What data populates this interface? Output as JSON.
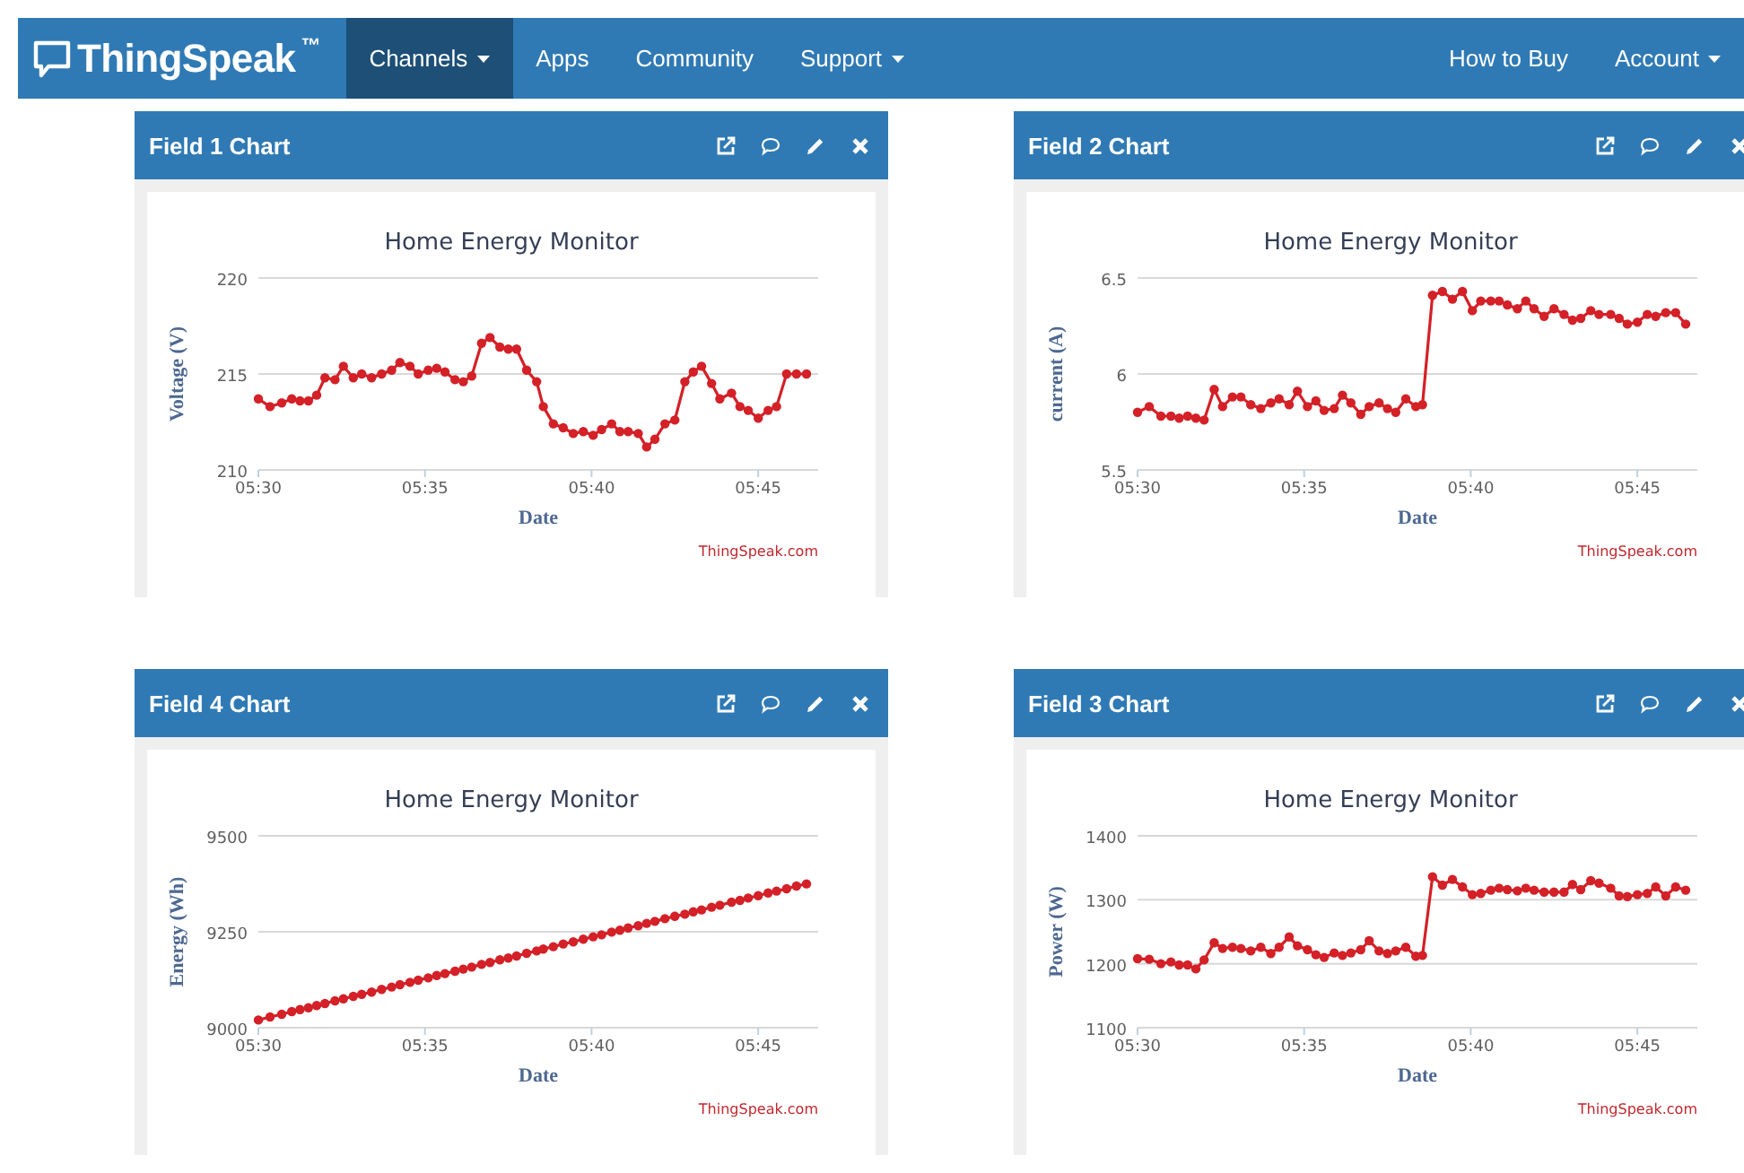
{
  "nav": {
    "logo": "ThingSpeak",
    "trademark": "™",
    "items": [
      {
        "label": "Channels",
        "dropdown": true,
        "selected": true
      },
      {
        "label": "Apps",
        "dropdown": false,
        "selected": false
      },
      {
        "label": "Community",
        "dropdown": false,
        "selected": false
      },
      {
        "label": "Support",
        "dropdown": true,
        "selected": false
      }
    ],
    "right_items": [
      {
        "label": "How to Buy",
        "dropdown": false,
        "selected": false
      },
      {
        "label": "Account",
        "dropdown": true,
        "selected": false
      }
    ]
  },
  "panels": [
    {
      "title": "Field 1 Chart",
      "credit": "ThingSpeak.com",
      "chart_data": {
        "type": "line",
        "title": "Home Energy Monitor",
        "xlabel": "Date",
        "ylabel": "Voltage (V)",
        "xlim": [
          330,
          346.8
        ],
        "ylim": [
          210,
          220
        ],
        "yticks": [
          210,
          215,
          220
        ],
        "xticks": [
          {
            "value": 330,
            "label": "05:30"
          },
          {
            "value": 335,
            "label": "05:35"
          },
          {
            "value": 340,
            "label": "05:40"
          },
          {
            "value": 345,
            "label": "05:45"
          }
        ],
        "x": [
          330,
          330.35,
          330.7,
          331,
          331.25,
          331.5,
          331.75,
          332,
          332.3,
          332.55,
          332.85,
          333.1,
          333.4,
          333.7,
          334,
          334.25,
          334.55,
          334.8,
          335.1,
          335.35,
          335.6,
          335.9,
          336.15,
          336.4,
          336.7,
          336.95,
          337.25,
          337.5,
          337.75,
          338.05,
          338.35,
          338.55,
          338.85,
          339.15,
          339.45,
          339.75,
          340.05,
          340.3,
          340.6,
          340.85,
          341.1,
          341.4,
          341.65,
          341.9,
          342.2,
          342.5,
          342.8,
          343.05,
          343.3,
          343.6,
          343.85,
          344.2,
          344.45,
          344.7,
          345,
          345.3,
          345.55,
          345.85,
          346.15,
          346.45
        ],
        "series": [
          {
            "color": "#d42027",
            "values": [
              213.7,
              213.3,
              213.5,
              213.7,
              213.6,
              213.6,
              213.9,
              214.8,
              214.7,
              215.4,
              214.8,
              215,
              214.8,
              215,
              215.2,
              215.6,
              215.4,
              215,
              215.2,
              215.3,
              215.1,
              214.7,
              214.6,
              214.9,
              216.6,
              216.9,
              216.4,
              216.3,
              216.3,
              215.2,
              214.6,
              213.3,
              212.4,
              212.2,
              211.9,
              212,
              211.8,
              212.1,
              212.4,
              212,
              212,
              211.9,
              211.2,
              211.6,
              212.4,
              212.6,
              214.6,
              215.1,
              215.4,
              214.5,
              213.7,
              214,
              213.3,
              213.1,
              212.7,
              213.1,
              213.3,
              215,
              215,
              215
            ]
          }
        ]
      }
    },
    {
      "title": "Field 2 Chart",
      "credit": "ThingSpeak.com",
      "chart_data": {
        "type": "line",
        "title": "Home Energy Monitor",
        "xlabel": "Date",
        "ylabel": "current (A)",
        "xlim": [
          330,
          346.8
        ],
        "ylim": [
          5.5,
          6.5
        ],
        "yticks": [
          5.5,
          6,
          6.5
        ],
        "xticks": [
          {
            "value": 330,
            "label": "05:30"
          },
          {
            "value": 335,
            "label": "05:35"
          },
          {
            "value": 340,
            "label": "05:40"
          },
          {
            "value": 345,
            "label": "05:45"
          }
        ],
        "x": [
          330,
          330.35,
          330.7,
          331,
          331.25,
          331.5,
          331.75,
          332,
          332.3,
          332.55,
          332.85,
          333.1,
          333.4,
          333.7,
          334,
          334.25,
          334.55,
          334.8,
          335.1,
          335.35,
          335.6,
          335.9,
          336.15,
          336.4,
          336.7,
          336.95,
          337.25,
          337.5,
          337.75,
          338.05,
          338.35,
          338.55,
          338.85,
          339.15,
          339.45,
          339.75,
          340.05,
          340.3,
          340.6,
          340.85,
          341.1,
          341.4,
          341.65,
          341.9,
          342.2,
          342.5,
          342.8,
          343.05,
          343.3,
          343.6,
          343.85,
          344.2,
          344.45,
          344.7,
          345,
          345.3,
          345.55,
          345.85,
          346.15,
          346.45
        ],
        "series": [
          {
            "color": "#d42027",
            "values": [
              5.8,
              5.83,
              5.78,
              5.78,
              5.77,
              5.78,
              5.77,
              5.76,
              5.92,
              5.83,
              5.88,
              5.88,
              5.84,
              5.82,
              5.85,
              5.87,
              5.84,
              5.91,
              5.83,
              5.86,
              5.81,
              5.82,
              5.89,
              5.85,
              5.79,
              5.83,
              5.85,
              5.82,
              5.8,
              5.87,
              5.83,
              5.84,
              6.41,
              6.43,
              6.39,
              6.43,
              6.33,
              6.38,
              6.38,
              6.38,
              6.36,
              6.34,
              6.38,
              6.34,
              6.3,
              6.34,
              6.31,
              6.28,
              6.29,
              6.33,
              6.31,
              6.31,
              6.29,
              6.26,
              6.27,
              6.31,
              6.3,
              6.32,
              6.32,
              6.26
            ]
          }
        ]
      }
    },
    {
      "title": "Field 4 Chart",
      "credit": "ThingSpeak.com",
      "chart_data": {
        "type": "line",
        "title": "Home Energy Monitor",
        "xlabel": "Date",
        "ylabel": "Energy (Wh)",
        "xlim": [
          330,
          346.8
        ],
        "ylim": [
          9000,
          9500
        ],
        "yticks": [
          9000,
          9250,
          9500
        ],
        "xticks": [
          {
            "value": 330,
            "label": "05:30"
          },
          {
            "value": 335,
            "label": "05:35"
          },
          {
            "value": 340,
            "label": "05:40"
          },
          {
            "value": 345,
            "label": "05:45"
          }
        ],
        "x": [
          330,
          330.35,
          330.7,
          331,
          331.25,
          331.5,
          331.75,
          332,
          332.3,
          332.55,
          332.85,
          333.1,
          333.4,
          333.7,
          334,
          334.25,
          334.55,
          334.8,
          335.1,
          335.35,
          335.6,
          335.9,
          336.15,
          336.4,
          336.7,
          336.95,
          337.25,
          337.5,
          337.75,
          338.05,
          338.35,
          338.55,
          338.85,
          339.15,
          339.45,
          339.75,
          340.05,
          340.3,
          340.6,
          340.85,
          341.1,
          341.4,
          341.65,
          341.9,
          342.2,
          342.5,
          342.8,
          343.05,
          343.3,
          343.6,
          343.85,
          344.2,
          344.45,
          344.7,
          345,
          345.3,
          345.55,
          345.85,
          346.15,
          346.45
        ],
        "series": [
          {
            "color": "#d42027",
            "values": [
              9020,
              9028,
              9035,
              9042,
              9047,
              9052,
              9058,
              9063,
              9070,
              9075,
              9082,
              9087,
              9093,
              9100,
              9106,
              9112,
              9118,
              9124,
              9130,
              9136,
              9141,
              9147,
              9153,
              9158,
              9165,
              9170,
              9177,
              9182,
              9187,
              9194,
              9200,
              9205,
              9211,
              9218,
              9224,
              9231,
              9237,
              9242,
              9249,
              9254,
              9260,
              9266,
              9272,
              9277,
              9284,
              9290,
              9296,
              9302,
              9307,
              9314,
              9319,
              9327,
              9332,
              9338,
              9344,
              9351,
              9356,
              9362,
              9369,
              9375
            ]
          }
        ]
      }
    },
    {
      "title": "Field 3 Chart",
      "credit": "ThingSpeak.com",
      "chart_data": {
        "type": "line",
        "title": "Home Energy Monitor",
        "xlabel": "Date",
        "ylabel": "Power (W)",
        "xlim": [
          330,
          346.8
        ],
        "ylim": [
          1100,
          1400
        ],
        "yticks": [
          1100,
          1200,
          1300,
          1400
        ],
        "xticks": [
          {
            "value": 330,
            "label": "05:30"
          },
          {
            "value": 335,
            "label": "05:35"
          },
          {
            "value": 340,
            "label": "05:40"
          },
          {
            "value": 345,
            "label": "05:45"
          }
        ],
        "x": [
          330,
          330.35,
          330.7,
          331,
          331.25,
          331.5,
          331.75,
          332,
          332.3,
          332.55,
          332.85,
          333.1,
          333.4,
          333.7,
          334,
          334.25,
          334.55,
          334.8,
          335.1,
          335.35,
          335.6,
          335.9,
          336.15,
          336.4,
          336.7,
          336.95,
          337.25,
          337.5,
          337.75,
          338.05,
          338.35,
          338.55,
          338.85,
          339.15,
          339.45,
          339.75,
          340.05,
          340.3,
          340.6,
          340.85,
          341.1,
          341.4,
          341.65,
          341.9,
          342.2,
          342.5,
          342.8,
          343.05,
          343.3,
          343.6,
          343.85,
          344.2,
          344.45,
          344.7,
          345,
          345.3,
          345.55,
          345.85,
          346.15,
          346.45
        ],
        "series": [
          {
            "color": "#d42027",
            "values": [
              1208,
              1207,
              1200,
              1203,
              1198,
              1198,
              1192,
              1206,
              1233,
              1224,
              1226,
              1224,
              1220,
              1226,
              1216,
              1226,
              1242,
              1228,
              1222,
              1214,
              1210,
              1217,
              1213,
              1217,
              1222,
              1236,
              1220,
              1216,
              1220,
              1226,
              1212,
              1213,
              1336,
              1323,
              1332,
              1320,
              1308,
              1310,
              1315,
              1318,
              1316,
              1314,
              1318,
              1315,
              1312,
              1312,
              1312,
              1324,
              1316,
              1330,
              1326,
              1318,
              1306,
              1305,
              1308,
              1310,
              1320,
              1306,
              1320,
              1315
            ]
          }
        ]
      }
    }
  ]
}
